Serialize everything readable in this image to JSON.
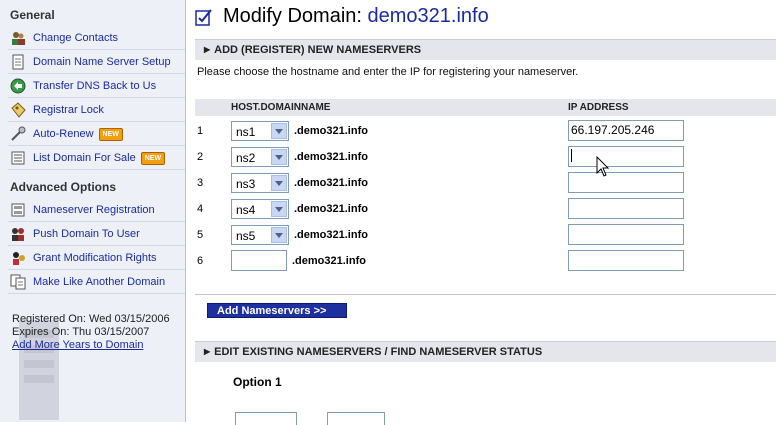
{
  "sidebar": {
    "general_heading": "General",
    "general_items": [
      {
        "label": "Change Contacts",
        "icon": "contacts-icon"
      },
      {
        "label": "Domain Name Server Setup",
        "icon": "document-icon"
      },
      {
        "label": "Transfer DNS Back to Us",
        "icon": "transfer-icon"
      },
      {
        "label": "Registrar Lock",
        "icon": "lock-tag-icon"
      },
      {
        "label": "Auto-Renew",
        "icon": "renew-icon",
        "badge": "NEW"
      },
      {
        "label": "List Domain For Sale",
        "icon": "list-icon",
        "badge": "NEW"
      }
    ],
    "advanced_heading": "Advanced Options",
    "advanced_items": [
      {
        "label": "Nameserver Registration",
        "icon": "server-icon"
      },
      {
        "label": "Push Domain To User",
        "icon": "push-user-icon"
      },
      {
        "label": "Grant Modification Rights",
        "icon": "grant-icon"
      },
      {
        "label": "Make Like Another Domain",
        "icon": "copy-icon"
      }
    ],
    "registered_on": "Registered On: Wed 03/15/2006",
    "expires_on": "Expires On: Thu 03/15/2007",
    "add_years_link": "Add More Years to Domain"
  },
  "main": {
    "title_prefix": "Modify Domain: ",
    "title_domain": "demo321.info",
    "add_section_title": "ADD (REGISTER) NEW NAMESERVERS",
    "description": "Please choose the hostname and enter the IP for registering your nameserver.",
    "col_host": "HOST.DOMAINNAME",
    "col_ip": "IP ADDRESS",
    "rows": [
      {
        "num": "1",
        "host": "ns1",
        "domain": ".demo321.info",
        "ip": "66.197.205.246"
      },
      {
        "num": "2",
        "host": "ns2",
        "domain": ".demo321.info",
        "ip": ""
      },
      {
        "num": "3",
        "host": "ns3",
        "domain": ".demo321.info",
        "ip": ""
      },
      {
        "num": "4",
        "host": "ns4",
        "domain": ".demo321.info",
        "ip": ""
      },
      {
        "num": "5",
        "host": "ns5",
        "domain": ".demo321.info",
        "ip": ""
      },
      {
        "num": "6",
        "host": "",
        "domain": ".demo321.info",
        "ip": ""
      }
    ],
    "add_button": "Add Nameservers >>",
    "edit_section_title": "EDIT EXISTING NAMESERVERS / FIND NAMESERVER STATUS",
    "option_title": "Option 1"
  },
  "colors": {
    "link": "#1a2ba0",
    "button_bg": "#1e2fa0",
    "sidebar_bg": "#eef0f8",
    "section_bg": "#e4e6ec",
    "badge": "#f0a010"
  }
}
